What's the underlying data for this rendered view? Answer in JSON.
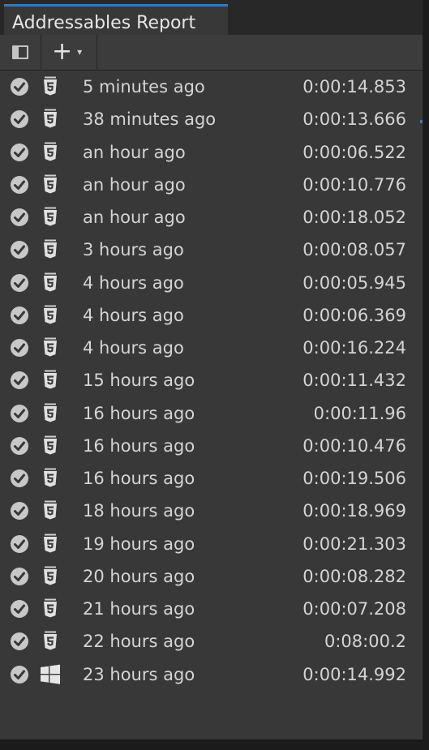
{
  "window": {
    "title": "Addressables Report"
  },
  "toolbar": {
    "add_label": "+",
    "add_caret": "▾"
  },
  "report_rows": [
    {
      "when": "5 minutes ago",
      "duration": "0:00:14.853",
      "platform": "html5-icon"
    },
    {
      "when": "38 minutes ago",
      "duration": "0:00:13.666",
      "platform": "html5-icon"
    },
    {
      "when": "an hour ago",
      "duration": "0:00:06.522",
      "platform": "html5-icon"
    },
    {
      "when": "an hour ago",
      "duration": "0:00:10.776",
      "platform": "html5-icon"
    },
    {
      "when": "an hour ago",
      "duration": "0:00:18.052",
      "platform": "html5-icon"
    },
    {
      "when": "3 hours ago",
      "duration": "0:00:08.057",
      "platform": "html5-icon"
    },
    {
      "when": "4 hours ago",
      "duration": "0:00:05.945",
      "platform": "html5-icon"
    },
    {
      "when": "4 hours ago",
      "duration": "0:00:06.369",
      "platform": "html5-icon"
    },
    {
      "when": "4 hours ago",
      "duration": "0:00:16.224",
      "platform": "html5-icon"
    },
    {
      "when": "15 hours ago",
      "duration": "0:00:11.432",
      "platform": "html5-icon"
    },
    {
      "when": "16 hours ago",
      "duration": "0:00:11.96",
      "platform": "html5-icon"
    },
    {
      "when": "16 hours ago",
      "duration": "0:00:10.476",
      "platform": "html5-icon"
    },
    {
      "when": "16 hours ago",
      "duration": "0:00:19.506",
      "platform": "html5-icon"
    },
    {
      "when": "18 hours ago",
      "duration": "0:00:18.969",
      "platform": "html5-icon"
    },
    {
      "when": "19 hours ago",
      "duration": "0:00:21.303",
      "platform": "html5-icon"
    },
    {
      "when": "20 hours ago",
      "duration": "0:00:08.282",
      "platform": "html5-icon"
    },
    {
      "when": "21 hours ago",
      "duration": "0:00:07.208",
      "platform": "html5-icon"
    },
    {
      "when": "22 hours ago",
      "duration": "0:08:00.2",
      "platform": "html5-icon"
    },
    {
      "when": "23 hours ago",
      "duration": "0:00:14.992",
      "platform": "windows-icon"
    }
  ],
  "colors": {
    "accent": "#3a79bb",
    "panel": "#383838",
    "text": "#d4d4d4"
  }
}
